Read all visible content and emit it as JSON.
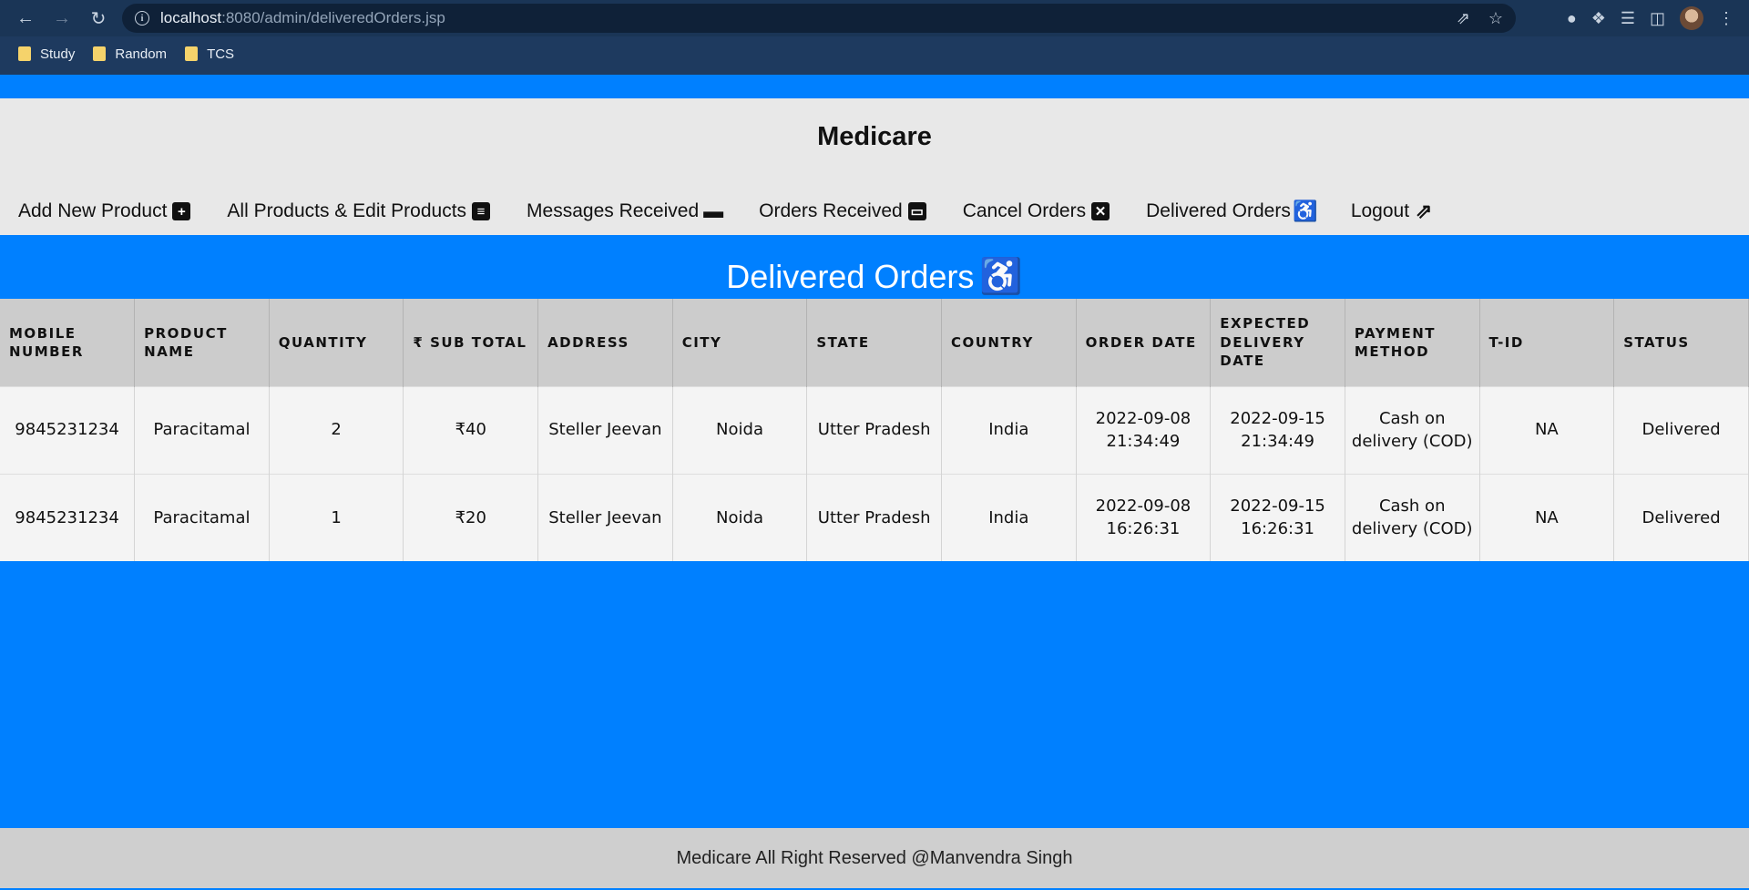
{
  "browser": {
    "url_host": "localhost",
    "url_rest": ":8080/admin/deliveredOrders.jsp",
    "bookmarks": [
      "Study",
      "Random",
      "TCS"
    ]
  },
  "site": {
    "brand": "Medicare"
  },
  "menu": [
    {
      "label": "Add New Product",
      "icon": "plus-square-icon",
      "glyph": "+"
    },
    {
      "label": "All Products & Edit Products",
      "icon": "list-icon",
      "glyph": "≡"
    },
    {
      "label": "Messages Received",
      "icon": "comment-icon",
      "glyph": "▬"
    },
    {
      "label": "Orders Received",
      "icon": "archive-icon",
      "glyph": "▭"
    },
    {
      "label": "Cancel Orders",
      "icon": "close-square-icon",
      "glyph": "✕"
    },
    {
      "label": "Delivered Orders",
      "icon": "dolly-icon",
      "glyph": "♿"
    },
    {
      "label": "Logout",
      "icon": "share-square-icon",
      "glyph": "⇗"
    }
  ],
  "section": {
    "title": "Delivered Orders"
  },
  "table": {
    "headers": [
      "MOBILE NUMBER",
      "PRODUCT NAME",
      "QUANTITY",
      "₹ SUB TOTAL",
      "ADDRESS",
      "CITY",
      "STATE",
      "COUNTRY",
      "ORDER DATE",
      "EXPECTED DELIVERY DATE",
      "PAYMENT METHOD",
      "T-ID",
      "STATUS"
    ],
    "rows": [
      [
        "9845231234",
        "Paracitamal",
        "2",
        "₹40",
        "Steller Jeevan",
        "Noida",
        "Utter Pradesh",
        "India",
        "2022-09-08 21:34:49",
        "2022-09-15 21:34:49",
        "Cash on delivery (COD)",
        "NA",
        "Delivered"
      ],
      [
        "9845231234",
        "Paracitamal",
        "1",
        "₹20",
        "Steller Jeevan",
        "Noida",
        "Utter Pradesh",
        "India",
        "2022-09-08 16:26:31",
        "2022-09-15 16:26:31",
        "Cash on delivery (COD)",
        "NA",
        "Delivered"
      ]
    ]
  },
  "footer": {
    "text": "Medicare All Right Reserved @Manvendra Singh"
  },
  "colors": {
    "page_bg": "#0080ff",
    "header_bg": "#e8e8e8",
    "table_header_bg": "#cccccc",
    "footer_bg": "#cfcfcf"
  }
}
